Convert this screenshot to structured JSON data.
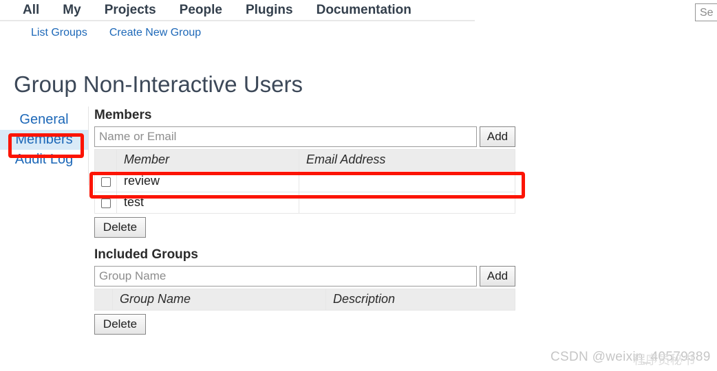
{
  "top_nav": {
    "items": [
      {
        "label": "All"
      },
      {
        "label": "My"
      },
      {
        "label": "Projects"
      },
      {
        "label": "People"
      },
      {
        "label": "Plugins"
      },
      {
        "label": "Documentation"
      }
    ]
  },
  "sub_nav": {
    "items": [
      {
        "label": "List Groups"
      },
      {
        "label": "Create New Group"
      }
    ]
  },
  "search": {
    "value": "",
    "placeholder": "Se"
  },
  "page": {
    "title": "Group Non-Interactive Users"
  },
  "side_tabs": {
    "items": [
      {
        "label": "General",
        "active": false
      },
      {
        "label": "Members",
        "active": true
      },
      {
        "label": "Audit Log",
        "active": false
      }
    ]
  },
  "members": {
    "heading": "Members",
    "input_placeholder": "Name or Email",
    "input_value": "",
    "add_label": "Add",
    "delete_label": "Delete",
    "columns": [
      "Member",
      "Email Address"
    ],
    "rows": [
      {
        "member": "review",
        "email": ""
      },
      {
        "member": "test",
        "email": ""
      }
    ]
  },
  "included_groups": {
    "heading": "Included Groups",
    "input_placeholder": "Group Name",
    "input_value": "",
    "add_label": "Add",
    "delete_label": "Delete",
    "columns": [
      "Group Name",
      "Description"
    ],
    "rows": []
  },
  "annotations": {
    "color": "#fc1403",
    "highlight_members_tab": "Members",
    "highlight_review_row": "review"
  },
  "watermark": {
    "text": "CSDN @weixin_40579389",
    "overlay_text": "程序员秘书"
  }
}
